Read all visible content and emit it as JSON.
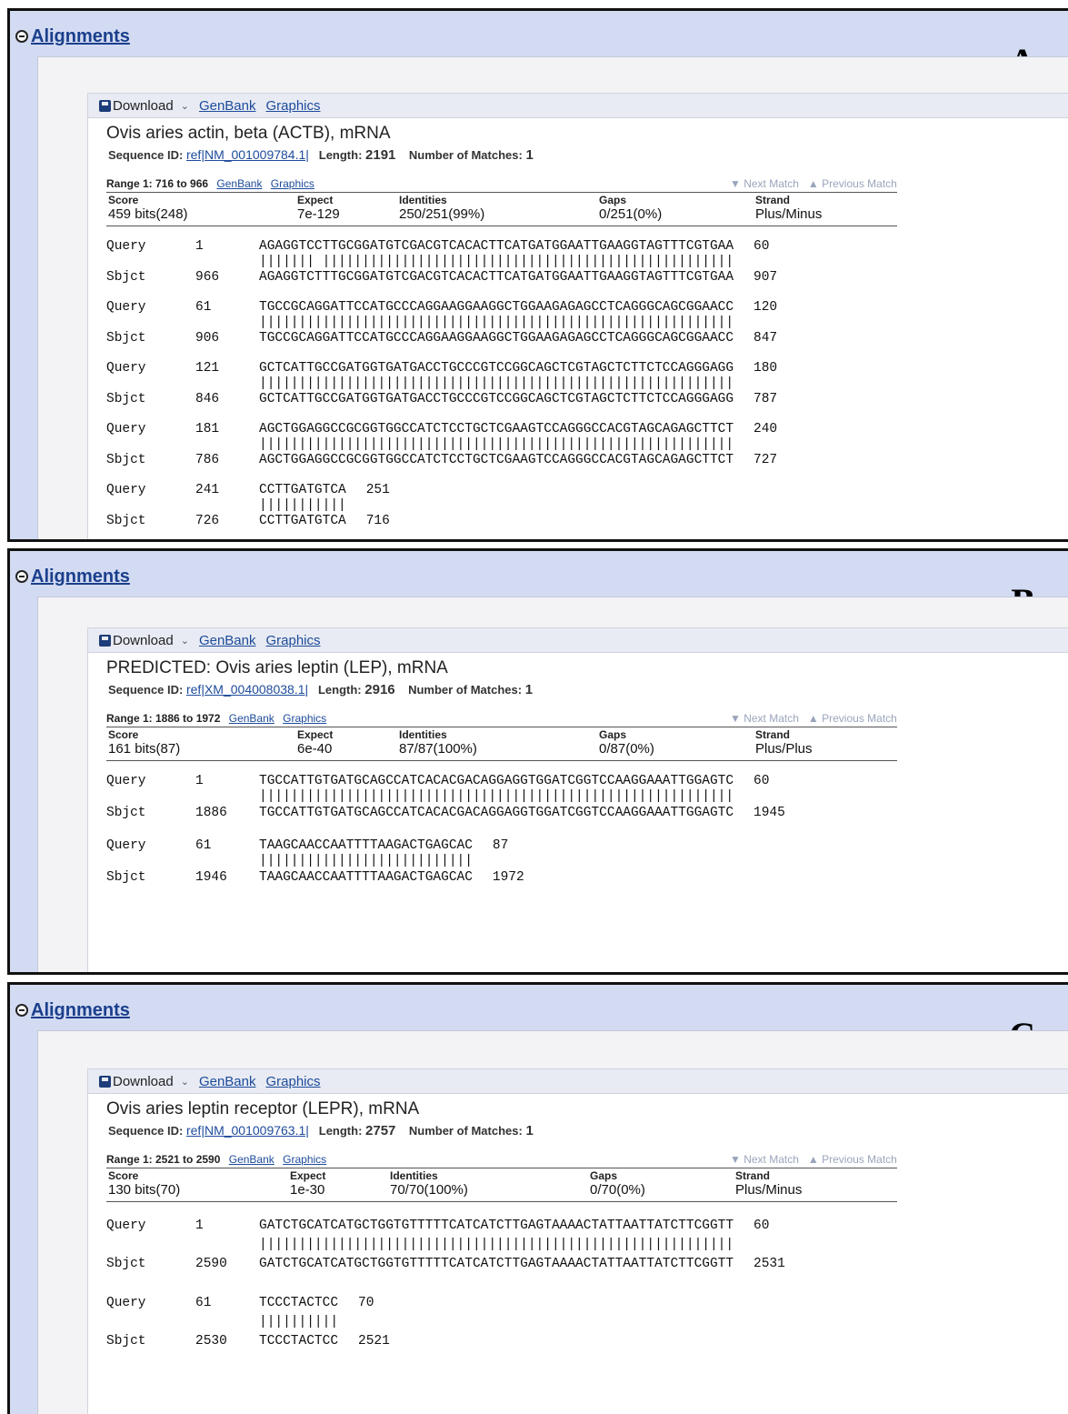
{
  "panels": [
    {
      "section_title": "Alignments",
      "letter": "A",
      "toolbar": {
        "download": "Download",
        "genbank": "GenBank",
        "graphics": "Graphics"
      },
      "title": "Ovis aries actin, beta (ACTB), mRNA",
      "seq_id_label": "Sequence ID:",
      "seq_id": "ref|NM_001009784.1|",
      "length_label": "Length:",
      "length": "2191",
      "matches_label": "Number of Matches:",
      "matches": "1",
      "range_text": "Range 1: 716 to 966",
      "range_genbank": "GenBank",
      "range_graphics": "Graphics",
      "next_match": "▼ Next Match",
      "previous_match": "▲ Previous Match",
      "stats": [
        {
          "label": "Score",
          "value": "459 bits(248)"
        },
        {
          "label": "Expect",
          "value": "7e-129"
        },
        {
          "label": "Identities",
          "value": "250/251(99%)"
        },
        {
          "label": "Gaps",
          "value": "0/251(0%)"
        },
        {
          "label": "Strand",
          "value": "Plus/Minus"
        }
      ],
      "alignments": [
        {
          "q_start": "1",
          "q_seq": "AGAGGTCCTTGCGGATGTCGACGTCACACTTCATGATGGAATTGAAGGTAGTTTCGTGAA",
          "q_end": "60",
          "bars": "||||||| ||||||||||||||||||||||||||||||||||||||||||||||||||||",
          "s_start": "966",
          "s_seq": "AGAGGTCTTTGCGGATGTCGACGTCACACTTCATGATGGAATTGAAGGTAGTTTCGTGAA",
          "s_end": "907"
        },
        {
          "q_start": "61",
          "q_seq": "TGCCGCAGGATTCCATGCCCAGGAAGGAAGGCTGGAAGAGAGCCTCAGGGCAGCGGAACC",
          "q_end": "120",
          "bars": "||||||||||||||||||||||||||||||||||||||||||||||||||||||||||||",
          "s_start": "906",
          "s_seq": "TGCCGCAGGATTCCATGCCCAGGAAGGAAGGCTGGAAGAGAGCCTCAGGGCAGCGGAACC",
          "s_end": "847"
        },
        {
          "q_start": "121",
          "q_seq": "GCTCATTGCCGATGGTGATGACCTGCCCGTCCGGCAGCTCGTAGCTCTTCTCCAGGGAGG",
          "q_end": "180",
          "bars": "||||||||||||||||||||||||||||||||||||||||||||||||||||||||||||",
          "s_start": "846",
          "s_seq": "GCTCATTGCCGATGGTGATGACCTGCCCGTCCGGCAGCTCGTAGCTCTTCTCCAGGGAGG",
          "s_end": "787"
        },
        {
          "q_start": "181",
          "q_seq": "AGCTGGAGGCCGCGGTGGCCATCTCCTGCTCGAAGTCCAGGGCCACGTAGCAGAGCTTCT",
          "q_end": "240",
          "bars": "||||||||||||||||||||||||||||||||||||||||||||||||||||||||||||",
          "s_start": "786",
          "s_seq": "AGCTGGAGGCCGCGGTGGCCATCTCCTGCTCGAAGTCCAGGGCCACGTAGCAGAGCTTCT",
          "s_end": "727"
        },
        {
          "q_start": "241",
          "q_seq": "CCTTGATGTCA",
          "q_end": "251",
          "bars": "|||||||||||",
          "s_start": "726",
          "s_seq": "CCTTGATGTCA",
          "s_end": "716"
        }
      ]
    },
    {
      "section_title": "Alignments",
      "letter": "B",
      "toolbar": {
        "download": "Download",
        "genbank": "GenBank",
        "graphics": "Graphics"
      },
      "title": "PREDICTED: Ovis aries leptin (LEP), mRNA",
      "seq_id_label": "Sequence ID:",
      "seq_id": "ref|XM_004008038.1|",
      "length_label": "Length:",
      "length": "2916",
      "matches_label": "Number of Matches:",
      "matches": "1",
      "range_text": "Range 1: 1886 to 1972",
      "range_genbank": "GenBank",
      "range_graphics": "Graphics",
      "next_match": "▼ Next Match",
      "previous_match": "▲ Previous Match",
      "stats": [
        {
          "label": "Score",
          "value": "161 bits(87)"
        },
        {
          "label": "Expect",
          "value": "6e-40"
        },
        {
          "label": "Identities",
          "value": "87/87(100%)"
        },
        {
          "label": "Gaps",
          "value": "0/87(0%)"
        },
        {
          "label": "Strand",
          "value": "Plus/Plus"
        }
      ],
      "alignments": [
        {
          "q_start": "1",
          "q_seq": "TGCCATTGTGATGCAGCCATCACACGACAGGAGGTGGATCGGTCCAAGGAAATTGGAGTC",
          "q_end": "60",
          "bars": "||||||||||||||||||||||||||||||||||||||||||||||||||||||||||||",
          "s_start": "1886",
          "s_seq": "TGCCATTGTGATGCAGCCATCACACGACAGGAGGTGGATCGGTCCAAGGAAATTGGAGTC",
          "s_end": "1945"
        },
        {
          "q_start": "61",
          "q_seq": "TAAGCAACCAATTTTAAGACTGAGCAC",
          "q_end": "87",
          "bars": "|||||||||||||||||||||||||||",
          "s_start": "1946",
          "s_seq": "TAAGCAACCAATTTTAAGACTGAGCAC",
          "s_end": "1972"
        }
      ]
    },
    {
      "section_title": "Alignments",
      "letter": "C",
      "toolbar": {
        "download": "Download",
        "genbank": "GenBank",
        "graphics": "Graphics"
      },
      "title": "Ovis aries leptin receptor (LEPR), mRNA",
      "seq_id_label": "Sequence ID:",
      "seq_id": "ref|NM_001009763.1|",
      "length_label": "Length:",
      "length": "2757",
      "matches_label": "Number of Matches:",
      "matches": "1",
      "range_text": "Range 1: 2521 to 2590",
      "range_genbank": "GenBank",
      "range_graphics": "Graphics",
      "next_match": "▼ Next Match",
      "previous_match": "▲ Previous Match",
      "stats": [
        {
          "label": "Score",
          "value": "130 bits(70)"
        },
        {
          "label": "Expect",
          "value": "1e-30"
        },
        {
          "label": "Identities",
          "value": "70/70(100%)"
        },
        {
          "label": "Gaps",
          "value": "0/70(0%)"
        },
        {
          "label": "Strand",
          "value": "Plus/Minus"
        }
      ],
      "alignments": [
        {
          "q_start": "1",
          "q_seq": "GATCTGCATCATGCTGGTGTTTTTCATCATCTTGAGTAAAACTATTAATTATCTTCGGTT",
          "q_end": "60",
          "bars": "||||||||||||||||||||||||||||||||||||||||||||||||||||||||||||",
          "s_start": "2590",
          "s_seq": "GATCTGCATCATGCTGGTGTTTTTCATCATCTTGAGTAAAACTATTAATTATCTTCGGTT",
          "s_end": "2531"
        },
        {
          "q_start": "61",
          "q_seq": "TCCCTACTCC",
          "q_end": "70",
          "bars": "||||||||||",
          "s_start": "2530",
          "s_seq": "TCCCTACTCC",
          "s_end": "2521"
        }
      ]
    }
  ],
  "labels": {
    "query": "Query",
    "sbjct": "Sbjct"
  }
}
